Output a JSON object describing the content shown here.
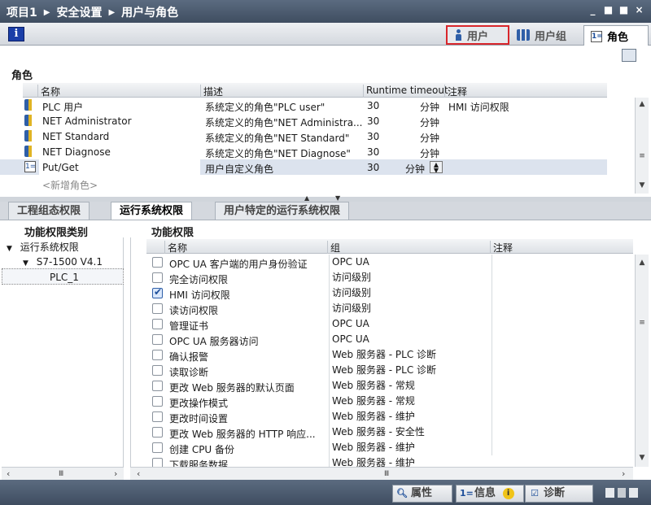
{
  "breadcrumb": [
    "项目1",
    "安全设置",
    "用户与角色"
  ],
  "window_buttons": [
    "_",
    "■",
    "■",
    "×"
  ],
  "top_tabs": [
    {
      "label": "用户",
      "highlighted": true
    },
    {
      "label": "用户组"
    },
    {
      "label": "角色",
      "active": true
    }
  ],
  "roles": {
    "heading": "角色",
    "columns": [
      "名称",
      "描述",
      "Runtime timeout",
      "注释"
    ],
    "rows": [
      {
        "name": "PLC 用户",
        "desc": "系统定义的角色\"PLC user\"",
        "timeout": "30",
        "unit": "分钟",
        "comment": "HMI 访问权限"
      },
      {
        "name": "NET Administrator",
        "desc": "系统定义的角色\"NET Administra...",
        "timeout": "30",
        "unit": "分钟",
        "comment": ""
      },
      {
        "name": "NET Standard",
        "desc": "系统定义的角色\"NET Standard\"",
        "timeout": "30",
        "unit": "分钟",
        "comment": ""
      },
      {
        "name": "NET Diagnose",
        "desc": "系统定义的角色\"NET Diagnose\"",
        "timeout": "30",
        "unit": "分钟",
        "comment": ""
      },
      {
        "name": "Put/Get",
        "desc": "用户自定义角色",
        "timeout": "30",
        "unit": "分钟",
        "comment": ""
      }
    ],
    "add_placeholder": "<新增角色>"
  },
  "bottom_tabs": [
    "工程组态权限",
    "运行系统权限",
    "用户特定的运行系统权限"
  ],
  "categories": {
    "title": "功能权限类别",
    "items": [
      "运行系统权限",
      "S7-1500 V4.1",
      "PLC_1"
    ]
  },
  "permissions": {
    "title": "功能权限",
    "columns": [
      "名称",
      "组",
      "注释"
    ],
    "rows": [
      {
        "name": "OPC UA 客户端的用户身份验证",
        "group": "OPC UA",
        "checked": false
      },
      {
        "name": "完全访问权限",
        "group": "访问级别",
        "checked": false
      },
      {
        "name": "HMI 访问权限",
        "group": "访问级别",
        "checked": true
      },
      {
        "name": "读访问权限",
        "group": "访问级别",
        "checked": false
      },
      {
        "name": "管理证书",
        "group": "OPC UA",
        "checked": false
      },
      {
        "name": "OPC UA 服务器访问",
        "group": "OPC UA",
        "checked": false
      },
      {
        "name": "确认报警",
        "group": "Web 服务器 - PLC 诊断",
        "checked": false
      },
      {
        "name": "读取诊断",
        "group": "Web 服务器 - PLC 诊断",
        "checked": false
      },
      {
        "name": "更改 Web 服务器的默认页面",
        "group": "Web 服务器 - 常规",
        "checked": false
      },
      {
        "name": "更改操作模式",
        "group": "Web 服务器 - 常规",
        "checked": false
      },
      {
        "name": "更改时间设置",
        "group": "Web 服务器 - 维护",
        "checked": false
      },
      {
        "name": "更改 Web 服务器的 HTTP 响应...",
        "group": "Web 服务器 - 安全性",
        "checked": false
      },
      {
        "name": "创建 CPU 备份",
        "group": "Web 服务器 - 维护",
        "checked": false
      },
      {
        "name": "下载服务数据",
        "group": "Web 服务器 - 维护",
        "checked": false
      }
    ]
  },
  "statusbar": {
    "properties": "属性",
    "info": "信息",
    "diagnostics": "诊断"
  }
}
